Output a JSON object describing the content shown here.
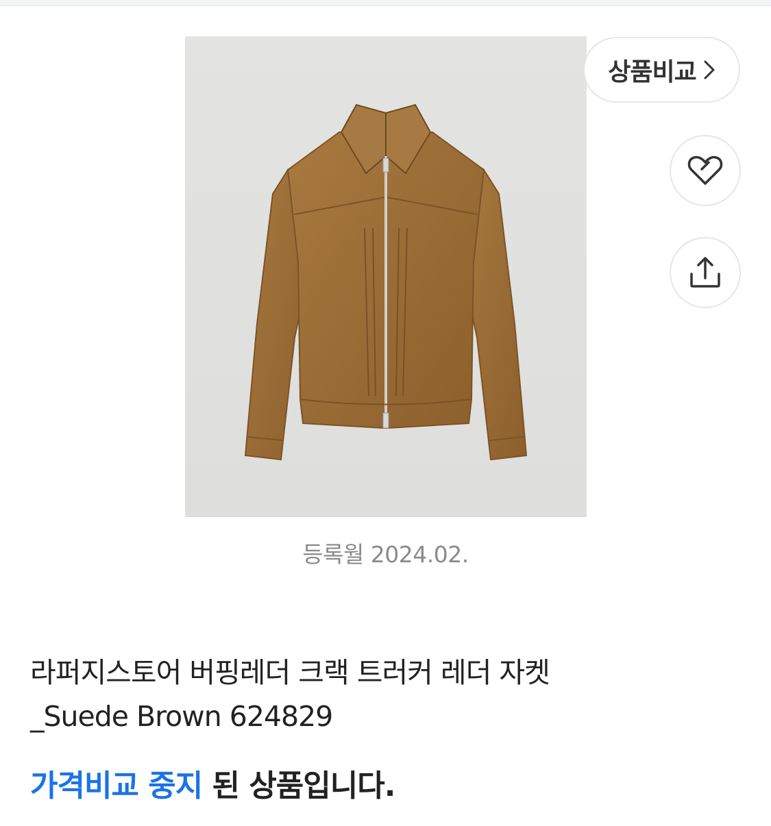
{
  "compare": {
    "label": "상품비교"
  },
  "icons": {
    "compare_chevron": "chevron-right-icon",
    "wish": "heart-outline-icon",
    "share": "share-upload-icon"
  },
  "product": {
    "image_alt": "라퍼지스토어 버핑레더 크랙 트러커 레더 자켓",
    "registered_label": "등록월 2024.02.",
    "title_line1": "라퍼지스토어 버핑레더 크랙 트러커 레더 자켓",
    "title_line2": "_Suede Brown 624829"
  },
  "status": {
    "highlight": "가격비교 중지",
    "rest": " 된 상품입니다."
  },
  "colors": {
    "accent": "#1a73e8",
    "jacket": "#9a6a33",
    "image_bg": "#e0e0de"
  }
}
